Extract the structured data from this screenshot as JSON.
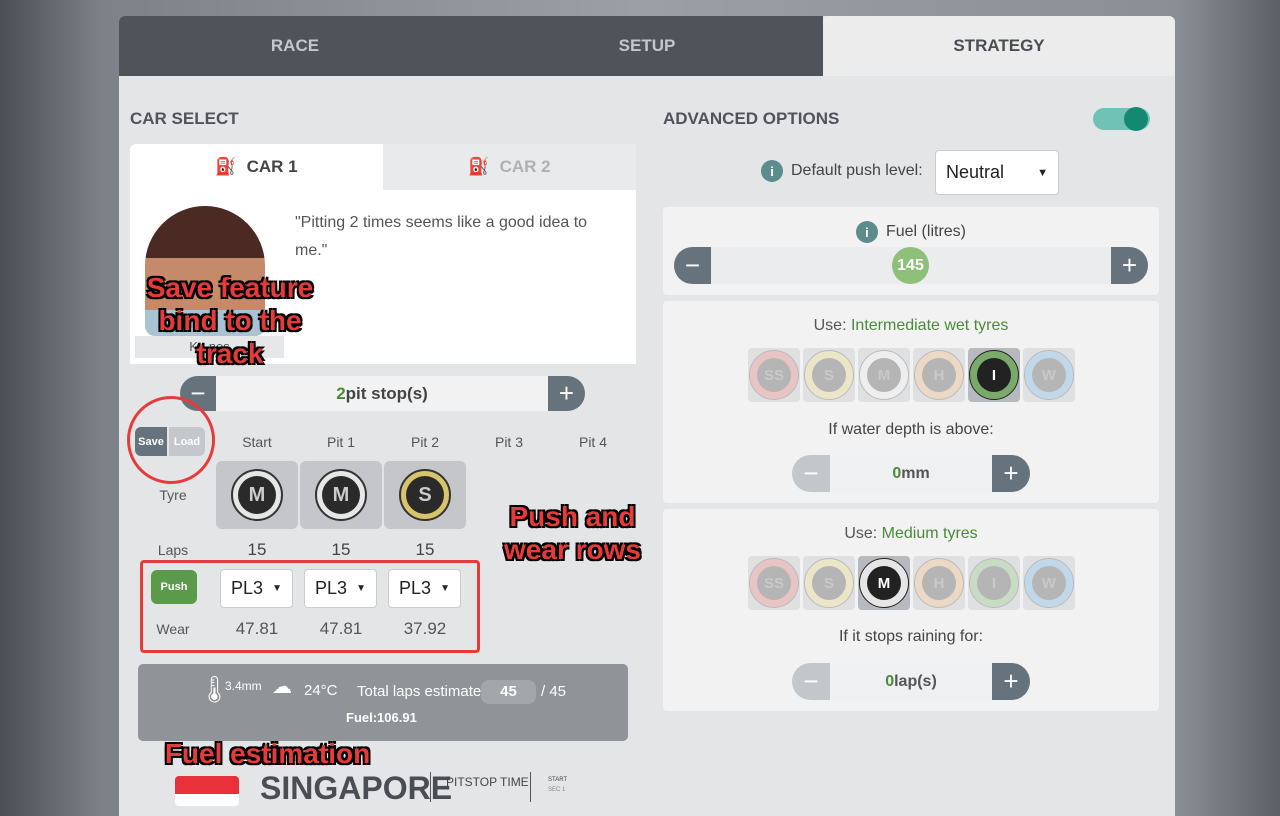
{
  "tabs": [
    {
      "label": "RACE"
    },
    {
      "label": "SETUP"
    },
    {
      "label": "STRATEGY"
    }
  ],
  "car_select": {
    "title": "CAR SELECT",
    "car_tabs": [
      {
        "label": "CAR 1"
      },
      {
        "label": "CAR 2"
      }
    ],
    "quote": "\"Pitting 2 times seems like a good idea to me.\"",
    "driver_name": "K...nes",
    "pit_stops": {
      "count": "2",
      "label": " pit stop(s)"
    },
    "save_label": "Save",
    "load_label": "Load",
    "columns": [
      "Start",
      "Pit 1",
      "Pit 2",
      "Pit 3",
      "Pit 4"
    ],
    "row_labels": {
      "tyre": "Tyre",
      "laps": "Laps",
      "push": "Push",
      "wear": "Wear"
    },
    "stints": [
      {
        "tyre": "M",
        "laps": "15",
        "push": "PL3",
        "wear": "47.81"
      },
      {
        "tyre": "M",
        "laps": "15",
        "push": "PL3",
        "wear": "47.81"
      },
      {
        "tyre": "S",
        "laps": "15",
        "push": "PL3",
        "wear": "37.92"
      }
    ]
  },
  "race_info": {
    "water": "3.4mm",
    "temp": "24°C",
    "laps_label": "Total laps estimate:",
    "laps_value": "45",
    "laps_total": "/ 45",
    "fuel": "Fuel:106.91"
  },
  "track": {
    "name": "SINGAPORE",
    "pitstop_label": "PITSTOP TIME",
    "legend": [
      "START",
      "SEC 1"
    ]
  },
  "annotations": {
    "save": "Save feature bind to the track",
    "push": "Push and wear rows",
    "fuel": "Fuel estimation"
  },
  "advanced": {
    "title": "ADVANCED OPTIONS",
    "toggle_on": true,
    "push_label": "Default push level:",
    "push_value": "Neutral",
    "fuel_label": "Fuel (litres)",
    "fuel_value": "145",
    "rule1": {
      "use": "Use: ",
      "tyre": "Intermediate wet tyres",
      "selected": "I",
      "cond": "If water depth is above:",
      "value": "0",
      "unit": "mm"
    },
    "rule2": {
      "use": "Use: ",
      "tyre": "Medium tyres",
      "selected": "M",
      "cond": "If it stops raining for:",
      "value": "0",
      "unit": " lap(s)"
    },
    "tyres": [
      "SS",
      "S",
      "M",
      "H",
      "I",
      "W"
    ]
  },
  "colors": {
    "accent_green": "#4a8a3a",
    "tyre_ring": {
      "SS": "#e8c4c4",
      "S": "#ece6c8",
      "M": "#eeeeee",
      "H": "#ecd8c4",
      "I": "#c8dcc4",
      "W": "#c0d8ea"
    }
  }
}
